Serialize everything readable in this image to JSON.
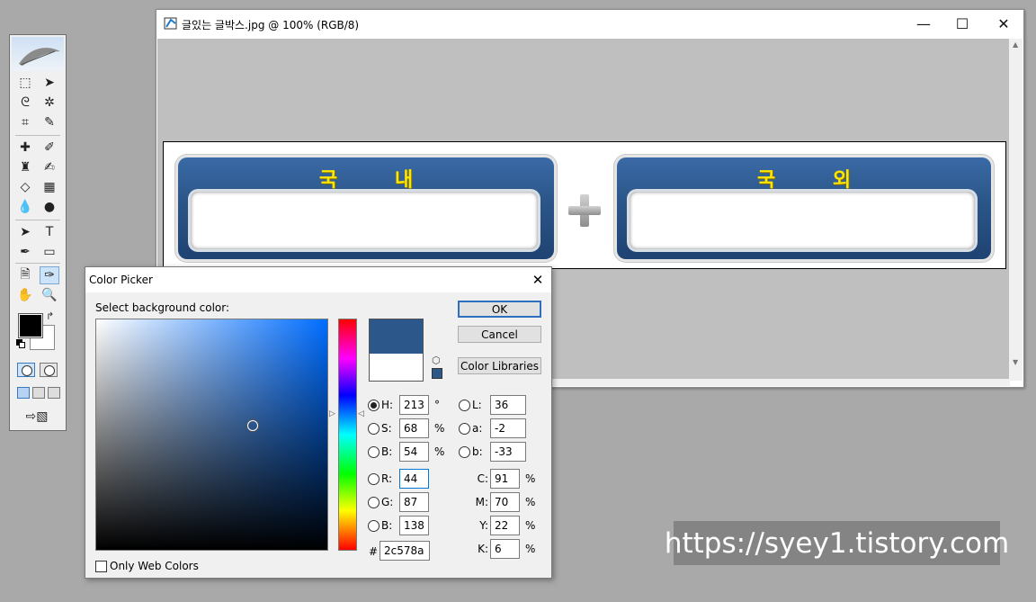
{
  "document": {
    "title": "글있는 글박스.jpg @ 100% (RGB/8)",
    "canvas": {
      "left_panel_title": "국 내",
      "right_panel_title": "국 외"
    }
  },
  "color_picker": {
    "title": "Color Picker",
    "prompt": "Select background color:",
    "buttons": {
      "ok": "OK",
      "cancel": "Cancel",
      "libraries": "Color Libraries"
    },
    "selected_mode": "H",
    "hsb": {
      "h": {
        "label": "H:",
        "value": "213",
        "unit": "°"
      },
      "s": {
        "label": "S:",
        "value": "68",
        "unit": "%"
      },
      "b": {
        "label": "B:",
        "value": "54",
        "unit": "%"
      }
    },
    "lab": {
      "l": {
        "label": "L:",
        "value": "36"
      },
      "a": {
        "label": "a:",
        "value": "-2"
      },
      "b": {
        "label": "b:",
        "value": "-33"
      }
    },
    "rgb": {
      "r": {
        "label": "R:",
        "value": "44"
      },
      "g": {
        "label": "G:",
        "value": "87"
      },
      "b": {
        "label": "B:",
        "value": "138"
      }
    },
    "cmyk": {
      "c": {
        "label": "C:",
        "value": "91",
        "unit": "%"
      },
      "m": {
        "label": "M:",
        "value": "70",
        "unit": "%"
      },
      "y": {
        "label": "Y:",
        "value": "22",
        "unit": "%"
      },
      "k": {
        "label": "K:",
        "value": "6",
        "unit": "%"
      }
    },
    "hex": {
      "label": "#",
      "value": "2c578a"
    },
    "only_web_colors": {
      "label": "Only Web Colors",
      "checked": false
    },
    "new_color": "#2c578a",
    "current_color": "#ffffff"
  },
  "toolbox": {
    "foreground_color": "#000000",
    "background_color": "#ffffff"
  },
  "watermark": "https://syey1.tistory.com"
}
